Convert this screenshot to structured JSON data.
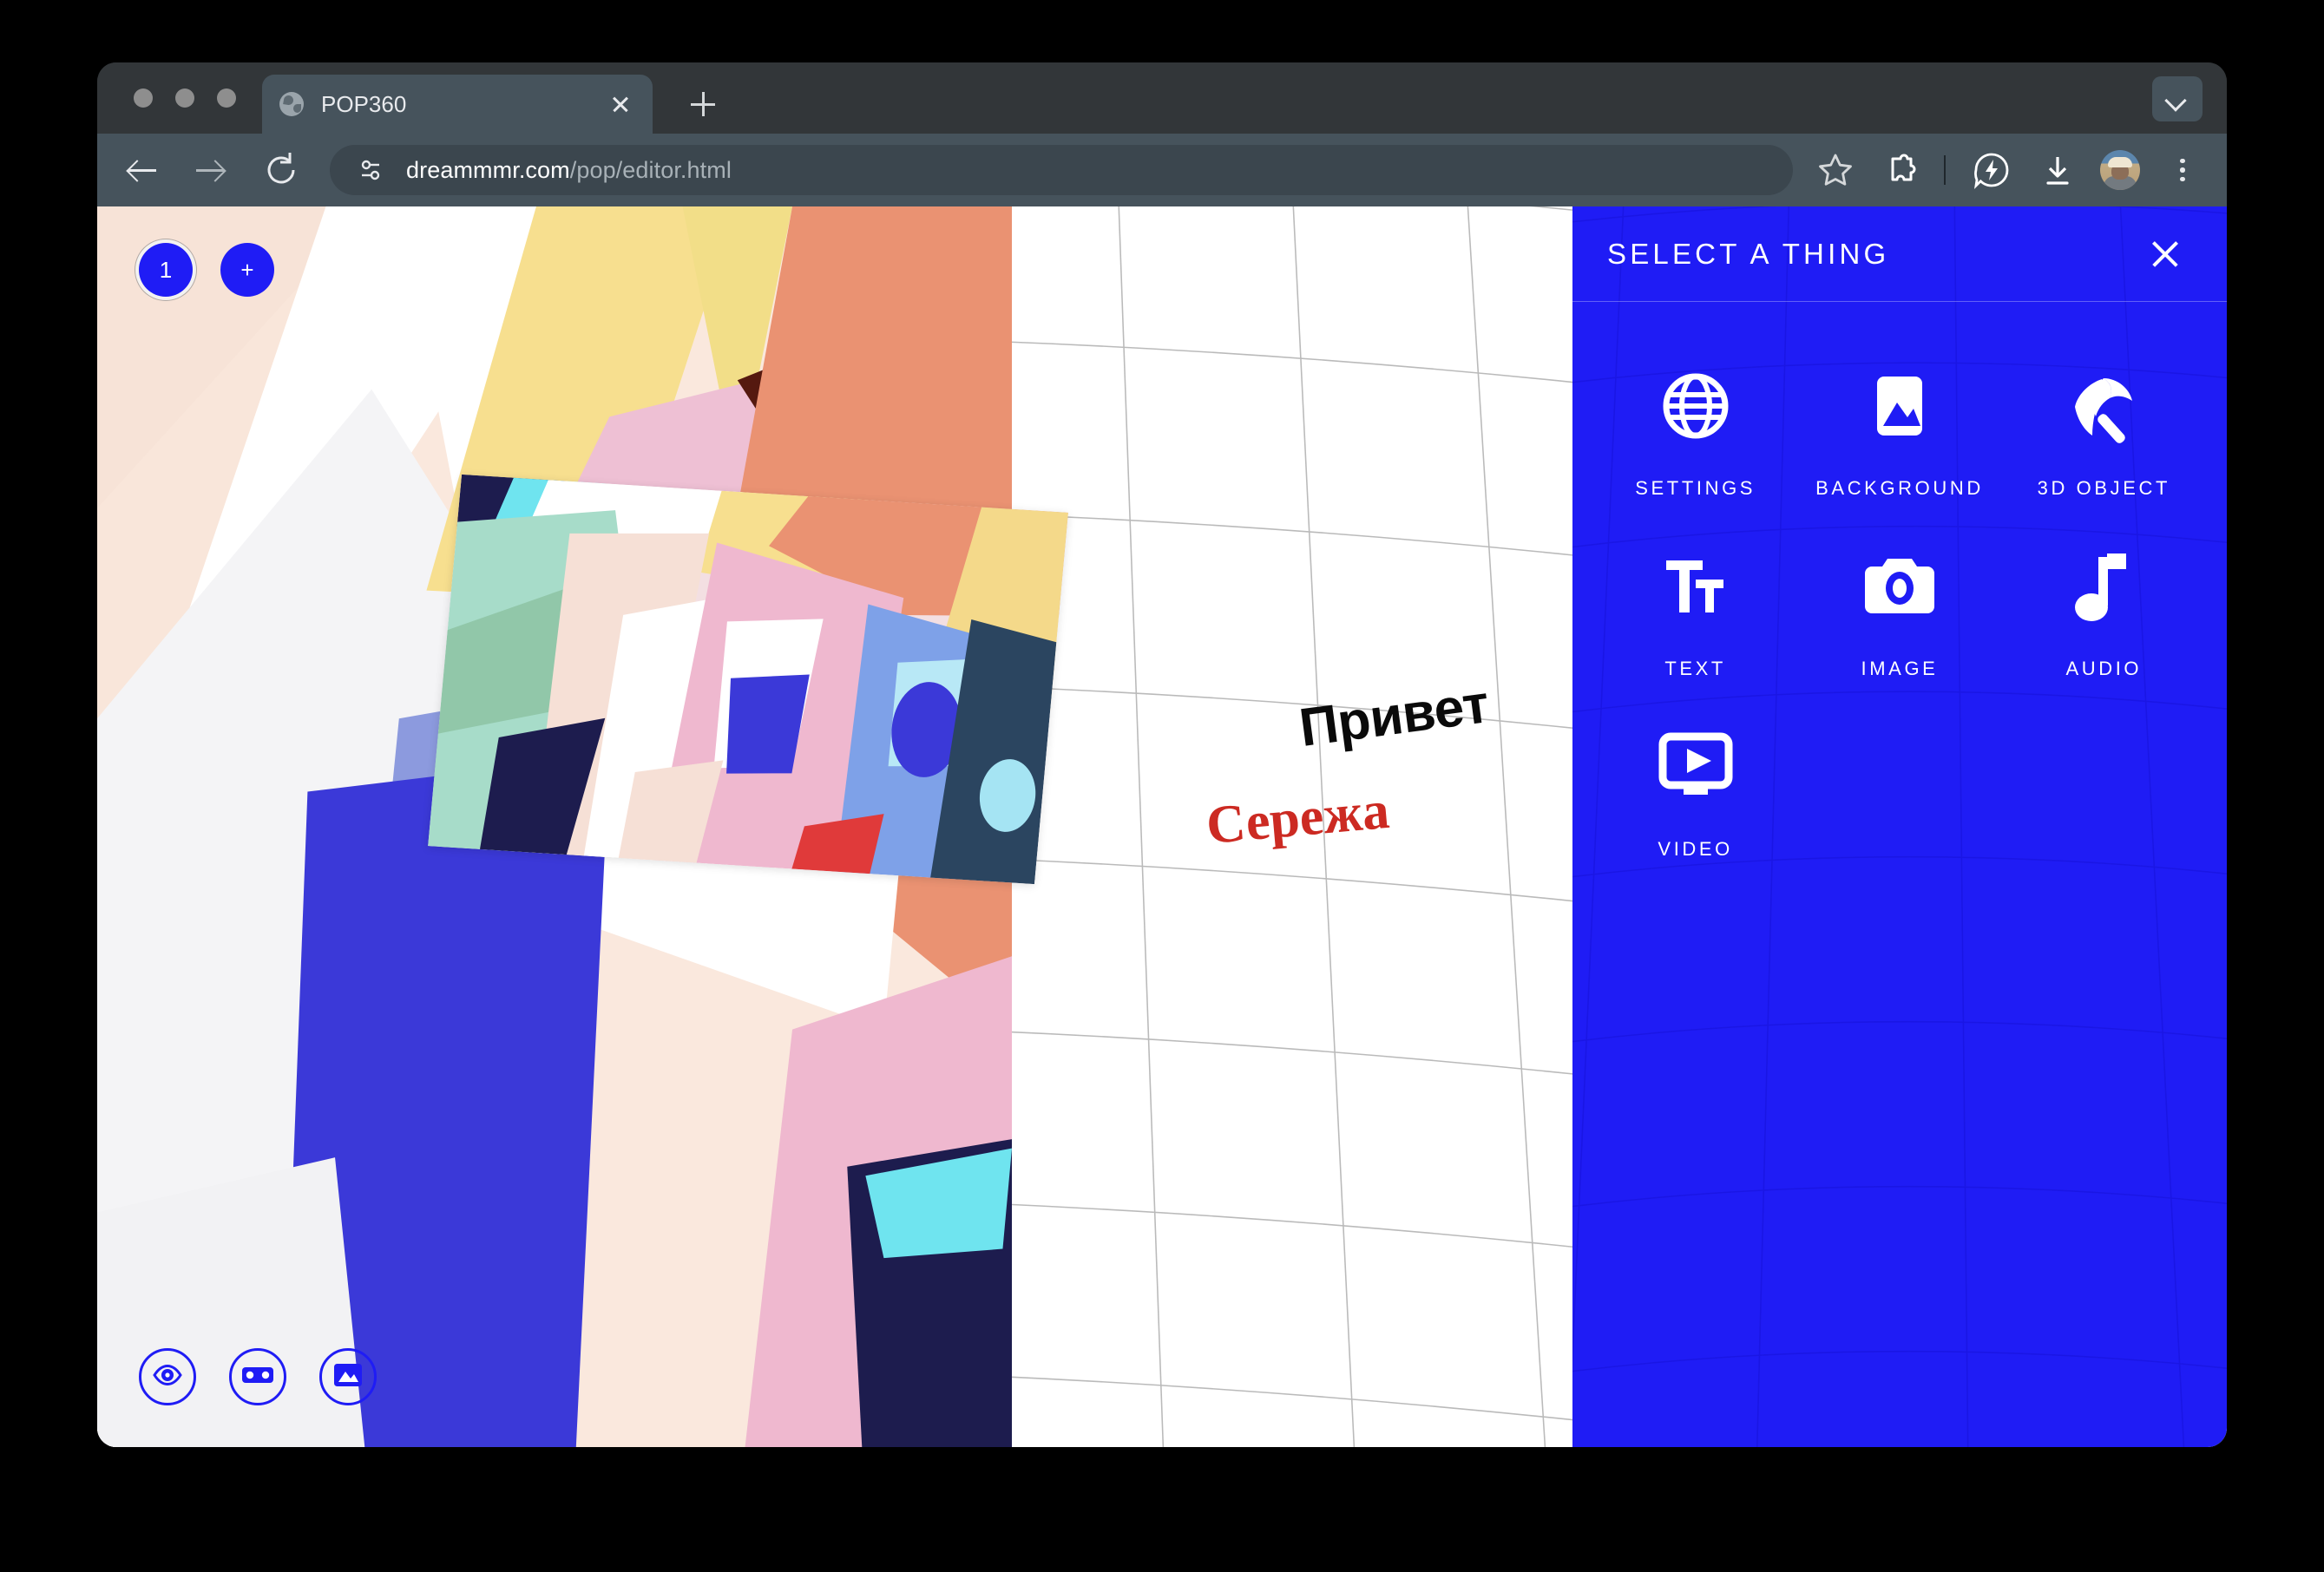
{
  "browser": {
    "tab": {
      "title": "POP360",
      "favicon": "globe-icon",
      "close": "close-icon"
    },
    "new_tab_label": "+",
    "tab_search": "chevron-down-icon",
    "url": {
      "domain": "dreammmr.com",
      "path": "/pop/editor.html"
    },
    "toolbar_icons": [
      "back-arrow-icon",
      "forward-arrow-icon",
      "reload-icon",
      "site-info-icon",
      "bookmark-star-icon",
      "extensions-puzzle-icon",
      "energy-saver-leaf-icon",
      "download-icon",
      "profile-avatar",
      "three-dot-menu-icon"
    ]
  },
  "canvas": {
    "scenes": [
      {
        "label": "1",
        "selected": true
      },
      {
        "label": "+",
        "selected": false
      }
    ],
    "tools": [
      {
        "name": "preview-eye-icon"
      },
      {
        "name": "vr-goggles-icon"
      },
      {
        "name": "background-image-icon"
      }
    ],
    "overlays": [
      {
        "text": "Привет",
        "style": "sans-bold-black"
      },
      {
        "text": "Сережа",
        "style": "serif-bold-red"
      }
    ]
  },
  "panel": {
    "title": "SELECT A THING",
    "close_label": "close-icon",
    "items": [
      {
        "label": "SETTINGS",
        "icon": "globe-icon"
      },
      {
        "label": "BACKGROUND",
        "icon": "image-icon"
      },
      {
        "label": "3D OBJECT",
        "icon": "umbrella-icon"
      },
      {
        "label": "TEXT",
        "icon": "text-format-icon"
      },
      {
        "label": "IMAGE",
        "icon": "camera-icon"
      },
      {
        "label": "AUDIO",
        "icon": "music-note-icon"
      },
      {
        "label": "VIDEO",
        "icon": "video-monitor-icon"
      }
    ]
  },
  "colors": {
    "brand_blue": "#1f1cf5",
    "accent_red": "#cc2a22",
    "chrome_tabstrip": "#323639",
    "chrome_toolbar": "#46535c",
    "url_pill": "#3b464e"
  }
}
